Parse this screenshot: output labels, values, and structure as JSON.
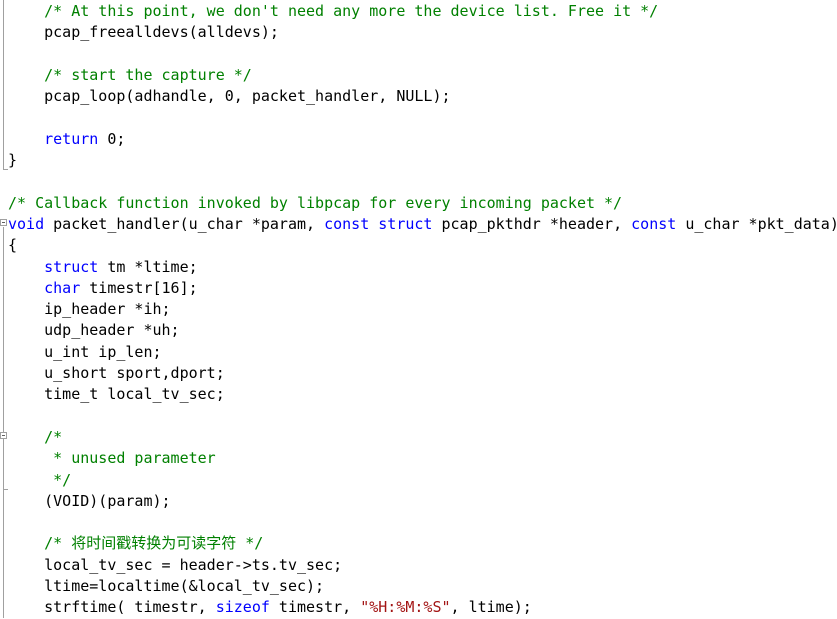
{
  "editor": {
    "colors": {
      "comment": "#008000",
      "keyword": "#0000ff",
      "string": "#a31515",
      "text": "#000000"
    },
    "lines": [
      [
        [
          "n",
          "    "
        ],
        [
          "c",
          "/* At this point, we don't need any more the device list. Free it */"
        ]
      ],
      [
        [
          "n",
          "    pcap_freealldevs(alldevs);"
        ]
      ],
      [],
      [
        [
          "n",
          "    "
        ],
        [
          "c",
          "/* start the capture */"
        ]
      ],
      [
        [
          "n",
          "    pcap_loop(adhandle, 0, packet_handler, NULL);"
        ]
      ],
      [],
      [
        [
          "n",
          "    "
        ],
        [
          "k",
          "return"
        ],
        [
          "n",
          " 0;"
        ]
      ],
      [
        [
          "n",
          "}"
        ]
      ],
      [],
      [
        [
          "c",
          "/* Callback function invoked by libpcap for every incoming packet */"
        ]
      ],
      [
        [
          "k",
          "void"
        ],
        [
          "n",
          " packet_handler(u_char *param, "
        ],
        [
          "k",
          "const"
        ],
        [
          "n",
          " "
        ],
        [
          "k",
          "struct"
        ],
        [
          "n",
          " pcap_pkthdr *header, "
        ],
        [
          "k",
          "const"
        ],
        [
          "n",
          " u_char *pkt_data)"
        ]
      ],
      [
        [
          "n",
          "{"
        ]
      ],
      [
        [
          "n",
          "    "
        ],
        [
          "k",
          "struct"
        ],
        [
          "n",
          " tm *ltime;"
        ]
      ],
      [
        [
          "n",
          "    "
        ],
        [
          "k",
          "char"
        ],
        [
          "n",
          " timestr[16];"
        ]
      ],
      [
        [
          "n",
          "    ip_header *ih;"
        ]
      ],
      [
        [
          "n",
          "    udp_header *uh;"
        ]
      ],
      [
        [
          "n",
          "    u_int ip_len;"
        ]
      ],
      [
        [
          "n",
          "    u_short sport,dport;"
        ]
      ],
      [
        [
          "n",
          "    time_t local_tv_sec;"
        ]
      ],
      [],
      [
        [
          "n",
          "    "
        ],
        [
          "c",
          "/*"
        ]
      ],
      [
        [
          "n",
          "     "
        ],
        [
          "c",
          "* unused parameter"
        ]
      ],
      [
        [
          "n",
          "     "
        ],
        [
          "c",
          "*/"
        ]
      ],
      [
        [
          "n",
          "    (VOID)(param);"
        ]
      ],
      [],
      [
        [
          "n",
          "    "
        ],
        [
          "c",
          "/* 将时间戳转换为可读字符 */"
        ]
      ],
      [
        [
          "n",
          "    local_tv_sec = header->ts.tv_sec;"
        ]
      ],
      [
        [
          "n",
          "    ltime=localtime(&local_tv_sec);"
        ]
      ],
      [
        [
          "n",
          "    strftime( timestr, "
        ],
        [
          "k",
          "sizeof"
        ],
        [
          "n",
          " timestr, "
        ],
        [
          "s",
          "\"%H:%M:%S\""
        ],
        [
          "n",
          ", ltime);"
        ]
      ]
    ]
  }
}
